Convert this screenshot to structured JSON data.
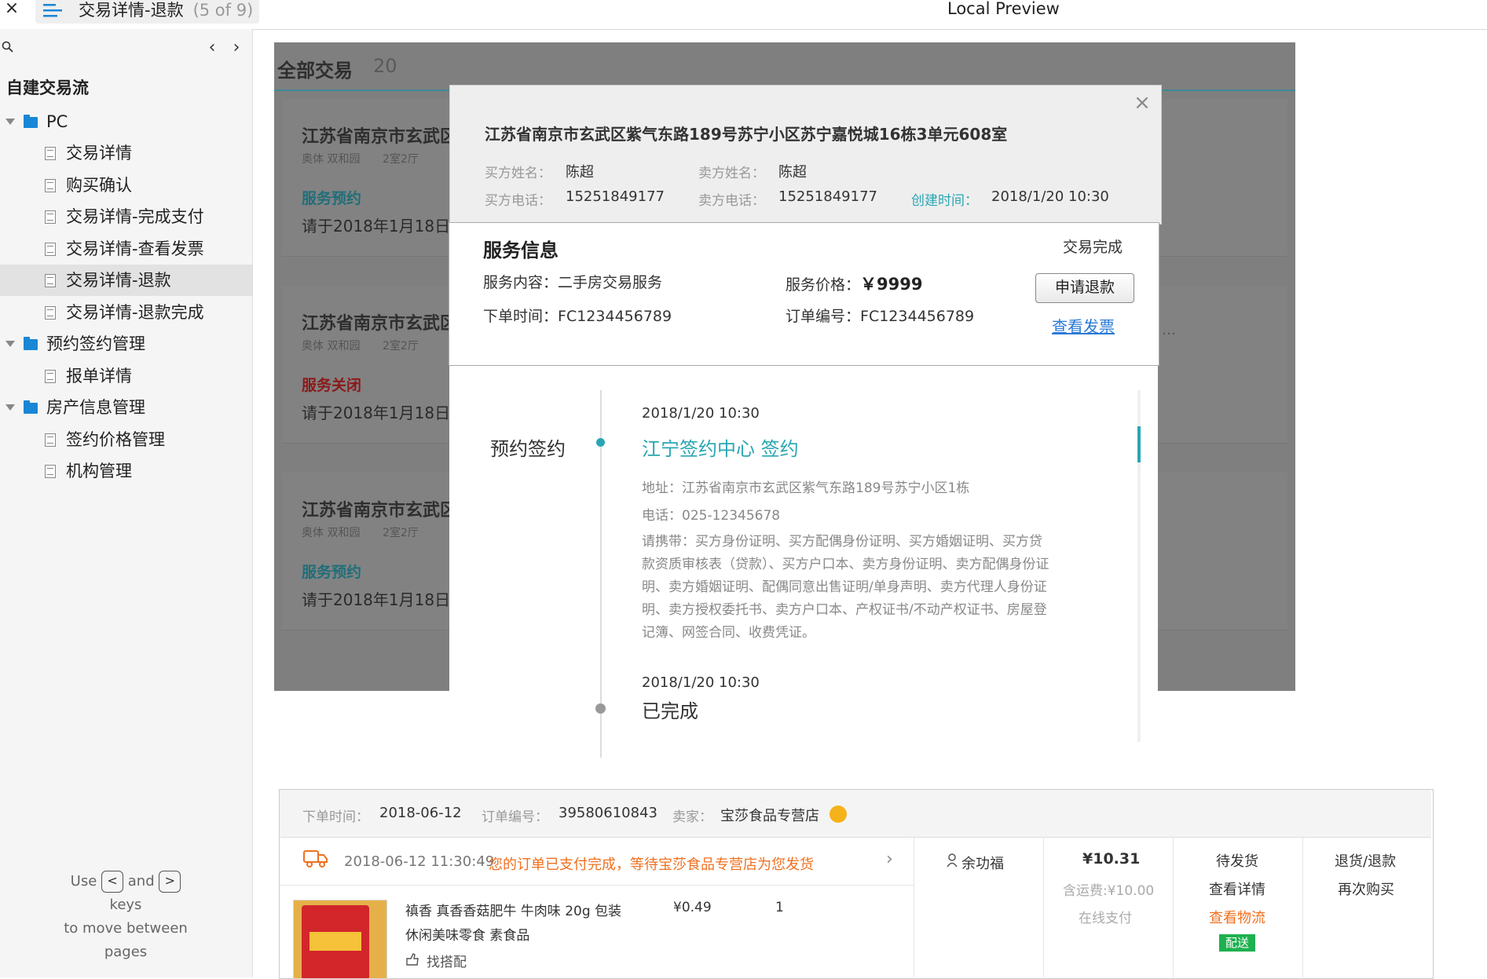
{
  "window": {
    "tab_title": "交易详情-退款",
    "tab_count": "(5 of 9)",
    "preview_title": "Local Preview"
  },
  "sidebar": {
    "root": "自建交易流",
    "items": [
      {
        "label": "PC",
        "type": "folder"
      },
      {
        "label": "交易详情",
        "type": "page"
      },
      {
        "label": "购买确认",
        "type": "page"
      },
      {
        "label": "交易详情-完成支付",
        "type": "page"
      },
      {
        "label": "交易详情-查看发票",
        "type": "page"
      },
      {
        "label": "交易详情-退款",
        "type": "page",
        "selected": true
      },
      {
        "label": "交易详情-退款完成",
        "type": "page"
      },
      {
        "label": "预约签约管理",
        "type": "folder"
      },
      {
        "label": "报单详情",
        "type": "page"
      },
      {
        "label": "房产信息管理",
        "type": "folder"
      },
      {
        "label": "签约价格管理",
        "type": "page"
      },
      {
        "label": "机构管理",
        "type": "page"
      }
    ],
    "hint": {
      "use": "Use",
      "and": "and",
      "keys": "keys",
      "line2": "to move between",
      "line3": "pages"
    }
  },
  "background": {
    "title": "全部交易",
    "count": "20",
    "cards": [
      {
        "addr": "江苏省南京市玄武区",
        "sub1": "奥体  双和园",
        "sub2": "2室2厅",
        "status": "服务预约",
        "status_color": "#1f6f7a",
        "date": "请于2018年1月18日"
      },
      {
        "addr": "江苏省南京市玄武区",
        "sub1": "奥体  双和园",
        "sub2": "2室2厅",
        "status": "服务关闭",
        "status_color": "#8a1a1a",
        "date": "请于2018年1月18日"
      },
      {
        "addr": "江苏省南京市玄武区",
        "sub1": "奥体  双和园",
        "sub2": "2室2厅",
        "status": "服务预约",
        "status_color": "#1f6f7a",
        "date": "请于2018年1月18日"
      }
    ]
  },
  "modal": {
    "address": "江苏省南京市玄武区紫气东路189号苏宁小区苏宁嘉悦城16栋3单元608室",
    "buyer_name_label": "买方姓名：",
    "buyer_name": "陈超",
    "seller_name_label": "卖方姓名：",
    "seller_name": "陈超",
    "buyer_phone_label": "买方电话：",
    "buyer_phone": "15251849177",
    "seller_phone_label": "卖方电话：",
    "seller_phone": "15251849177",
    "created_label": "创建时间：",
    "created": "2018/1/20  10:30",
    "service": {
      "title": "服务信息",
      "status": "交易完成",
      "content_label": "服务内容：",
      "content": "二手房交易服务",
      "price_label": "服务价格：",
      "price": "￥9999",
      "order_time_label": "下单时间：",
      "order_time": "FC1234456789",
      "order_no_label": "订单编号：",
      "order_no": "FC1234456789",
      "refund_button": "申请退款",
      "invoice_link": "查看发票"
    },
    "timeline": {
      "stage": "预约签约",
      "time1": "2018/1/20  10:30",
      "location": "江宁签约中心 签约",
      "address": "地址：江苏省南京市玄武区紫气东路189号苏宁小区1栋",
      "phone": "电话：025-12345678",
      "carry": "请携带：买方身份证明、买方配偶身份证明、买方婚姻证明、买方贷款资质审核表（贷款）、买方户口本、卖方身份证明、卖方配偶身份证明、卖方婚姻证明、配偶同意出售证明/单身声明、卖方代理人身份证明、卖方授权委托书、卖方户口本、产权证书/不动产权证书、房屋登记簿、网签合同、收费凭证。",
      "time2": "2018/1/20  10:30",
      "done": "已完成"
    }
  },
  "order": {
    "order_time_label": "下单时间：",
    "order_time": "2018-06-12",
    "order_no_label": "订单编号：",
    "order_no": "39580610843",
    "seller_label": "卖家：",
    "seller": "宝莎食品专营店",
    "ship_time": "2018-06-12 11:30:49",
    "ship_msg": "您的订单已支付完成，等待宝莎食品专营店为您发货",
    "buyer": "余功福",
    "total": "¥10.31",
    "ship_fee": "含运费:¥10.00",
    "pay_type": "在线支付",
    "status": "待发货",
    "detail": "查看详情",
    "logistics": "查看物流",
    "deliver": "配送",
    "refund": "退货/退款",
    "rebuy": "再次购买",
    "product_name": "禛香 真香香菇肥牛 牛肉味 20g 包装 休闲美味零食 素食品",
    "product_price": "¥0.49",
    "product_qty": "1",
    "match": "找搭配"
  },
  "colors": {
    "accent": "#2aa6b3",
    "link": "#2a7ad6",
    "orange": "#f07020",
    "green": "#1db14f",
    "folder": "#1a86d6"
  }
}
